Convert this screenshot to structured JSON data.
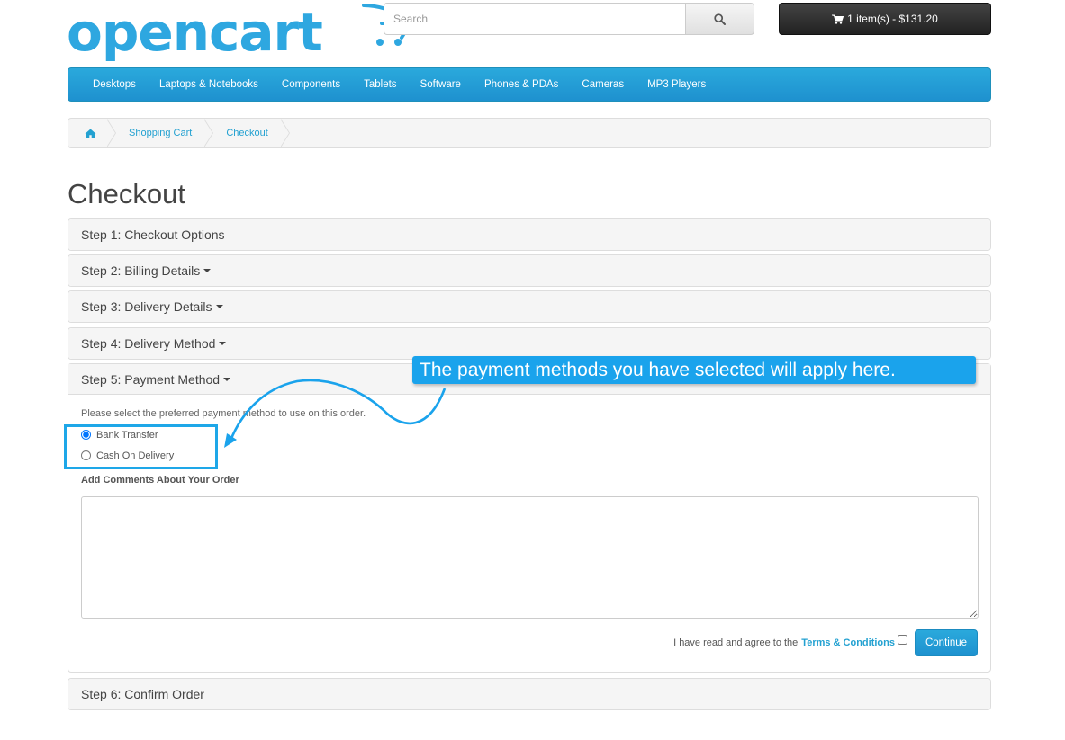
{
  "header": {
    "logo_text": "opencart",
    "search_placeholder": "Search",
    "cart_label": "1 item(s) - $131.20"
  },
  "menu": {
    "items": [
      "Desktops",
      "Laptops & Notebooks",
      "Components",
      "Tablets",
      "Software",
      "Phones & PDAs",
      "Cameras",
      "MP3 Players"
    ]
  },
  "breadcrumb": {
    "items": [
      "Shopping Cart",
      "Checkout"
    ]
  },
  "page": {
    "title": "Checkout"
  },
  "steps": {
    "step1": "Step 1: Checkout Options",
    "step2": "Step 2: Billing Details",
    "step3": "Step 3: Delivery Details",
    "step4": "Step 4: Delivery Method",
    "step5": "Step 5: Payment Method",
    "step6": "Step 6: Confirm Order"
  },
  "payment": {
    "intro": "Please select the preferred payment method to use on this order.",
    "options": [
      "Bank Transfer",
      "Cash On Delivery"
    ],
    "selected": "Bank Transfer",
    "comments_label": "Add Comments About Your Order",
    "comments_value": "",
    "agree_text": "I have read and agree to the",
    "terms_link": "Terms & Conditions",
    "continue_label": "Continue"
  },
  "annotation": {
    "callout_text": "The payment methods you have selected will apply here."
  },
  "colors": {
    "brand_blue": "#2ea7e0",
    "menu_blue": "#1e91cf",
    "callout_blue": "#1aa3ec"
  }
}
